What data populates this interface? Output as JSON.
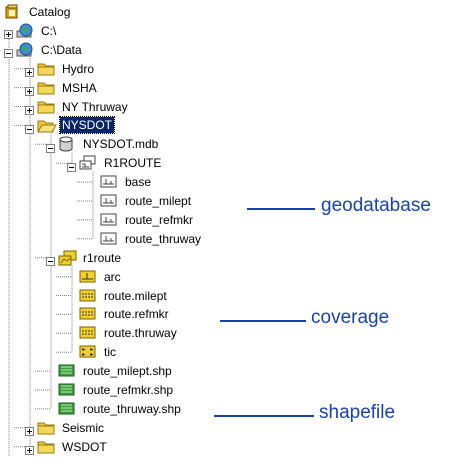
{
  "colors": {
    "annotation": "#1a3fae",
    "selection": "#0a246a",
    "folder": "#f0c832",
    "coverage": "#e8d21c",
    "shape": "#3aa13a"
  },
  "tree": [
    {
      "id": "catalog",
      "label": "Catalog",
      "icon": "catalog-icon",
      "level": 0,
      "toggle": "",
      "row": 0
    },
    {
      "id": "c-root",
      "label": "C:\\",
      "icon": "drive-globe-icon",
      "level": 0,
      "toggle": "+",
      "row": 1
    },
    {
      "id": "c-data",
      "label": "C:\\Data",
      "icon": "drive-globe-icon",
      "level": 0,
      "toggle": "-",
      "row": 2
    },
    {
      "id": "hydro",
      "label": "Hydro",
      "icon": "folder-icon",
      "level": 1,
      "toggle": "+",
      "row": 3
    },
    {
      "id": "msha",
      "label": "MSHA",
      "icon": "folder-icon",
      "level": 1,
      "toggle": "+",
      "row": 4
    },
    {
      "id": "ny-thruway",
      "label": "NY Thruway",
      "icon": "folder-icon",
      "level": 1,
      "toggle": "+",
      "row": 5
    },
    {
      "id": "nysdot",
      "label": "NYSDOT",
      "icon": "open-folder-icon",
      "level": 1,
      "toggle": "-",
      "row": 6,
      "selected": true
    },
    {
      "id": "nysdot-mdb",
      "label": "NYSDOT.mdb",
      "icon": "database-icon",
      "level": 2,
      "toggle": "-",
      "row": 7
    },
    {
      "id": "r1route-ds",
      "label": "R1ROUTE",
      "icon": "feature-dataset-icon",
      "level": 3,
      "toggle": "-",
      "row": 8
    },
    {
      "id": "fc-base",
      "label": "base",
      "icon": "feature-class-icon",
      "level": 4,
      "toggle": "",
      "row": 9
    },
    {
      "id": "fc-milept",
      "label": "route_milept",
      "icon": "feature-class-icon",
      "level": 4,
      "toggle": "",
      "row": 10
    },
    {
      "id": "fc-refmkr",
      "label": "route_refmkr",
      "icon": "feature-class-icon",
      "level": 4,
      "toggle": "",
      "row": 11
    },
    {
      "id": "fc-thruway",
      "label": "route_thruway",
      "icon": "feature-class-icon",
      "level": 4,
      "toggle": "",
      "row": 12
    },
    {
      "id": "r1route-cov",
      "label": "r1route",
      "icon": "coverage-icon",
      "level": 2,
      "toggle": "-",
      "row": 13
    },
    {
      "id": "cov-arc",
      "label": "arc",
      "icon": "coverage-arc-icon",
      "level": 3,
      "toggle": "",
      "row": 14
    },
    {
      "id": "cov-milept",
      "label": "route.milept",
      "icon": "coverage-route-icon",
      "level": 3,
      "toggle": "",
      "row": 15
    },
    {
      "id": "cov-refmkr",
      "label": "route.refmkr",
      "icon": "coverage-route-icon",
      "level": 3,
      "toggle": "",
      "row": 16
    },
    {
      "id": "cov-thruway",
      "label": "route.thruway",
      "icon": "coverage-route-icon",
      "level": 3,
      "toggle": "",
      "row": 17
    },
    {
      "id": "cov-tic",
      "label": "tic",
      "icon": "coverage-tic-icon",
      "level": 3,
      "toggle": "",
      "row": 18
    },
    {
      "id": "shp-milept",
      "label": "route_milept.shp",
      "icon": "shapefile-icon",
      "level": 2,
      "toggle": "",
      "row": 19
    },
    {
      "id": "shp-refmkr",
      "label": "route_refmkr.shp",
      "icon": "shapefile-icon",
      "level": 2,
      "toggle": "",
      "row": 20
    },
    {
      "id": "shp-thruway",
      "label": "route_thruway.shp",
      "icon": "shapefile-icon",
      "level": 2,
      "toggle": "",
      "row": 21
    },
    {
      "id": "seismic",
      "label": "Seismic",
      "icon": "folder-icon",
      "level": 1,
      "toggle": "+",
      "row": 22
    },
    {
      "id": "wsdot",
      "label": "WSDOT",
      "icon": "folder-icon",
      "level": 1,
      "toggle": "+",
      "row": 23
    }
  ],
  "annotations": {
    "geodatabase": "geodatabase",
    "coverage": "coverage",
    "shapefile": "shapefile"
  }
}
